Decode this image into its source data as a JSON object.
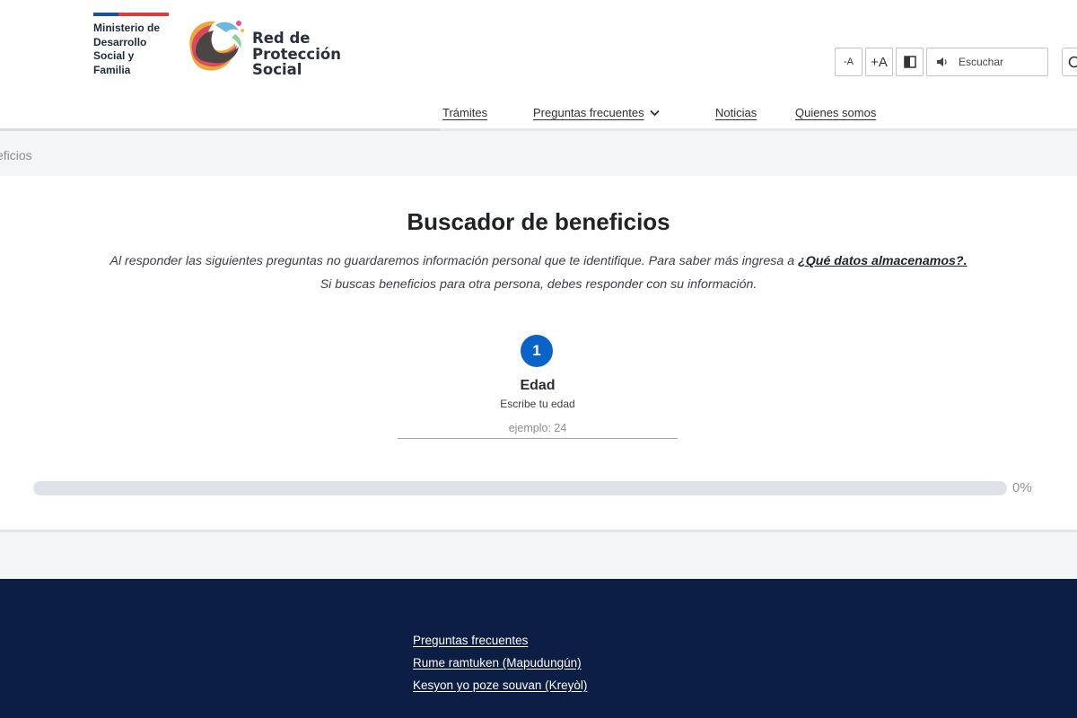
{
  "header": {
    "ministry_name": "Ministerio de\nDesarrollo\nSocial y\nFamilia",
    "network_name": "Red de\nProtección\nSocial",
    "tools": {
      "decrease_font": "-A",
      "increase_font": "+A",
      "listen_label": "Escuchar"
    }
  },
  "nav": {
    "items": [
      {
        "label": "Trámites"
      },
      {
        "label": "Preguntas frecuentes"
      },
      {
        "label": "Noticias"
      },
      {
        "label": "Quienes somos"
      }
    ]
  },
  "breadcrumb": {
    "current": "eficios"
  },
  "main": {
    "title": "Buscador de beneficios",
    "intro_line1": "Al responder las siguientes preguntas no guardaremos información personal que te identifique. Para saber más ingresa a",
    "intro_link": "¿Qué datos almacenamos?.",
    "intro_line2": "Si buscas beneficios para otra persona, debes responder con su información.",
    "step": {
      "number": "1",
      "title": "Edad",
      "help": "Escribe tu edad",
      "placeholder": "ejemplo: 24",
      "value": ""
    },
    "progress": {
      "percent": 0,
      "label": "0%"
    }
  },
  "footer": {
    "links": [
      {
        "label": "Preguntas frecuentes"
      },
      {
        "label": "Rume ramtuken (Mapudungún)"
      },
      {
        "label": "Kesyon yo poze souvan (Kreyòl)"
      }
    ]
  },
  "colors": {
    "accent": "#0a63c9",
    "footer_bg": "#0c1e44",
    "band_bg": "#f4f5f6"
  }
}
